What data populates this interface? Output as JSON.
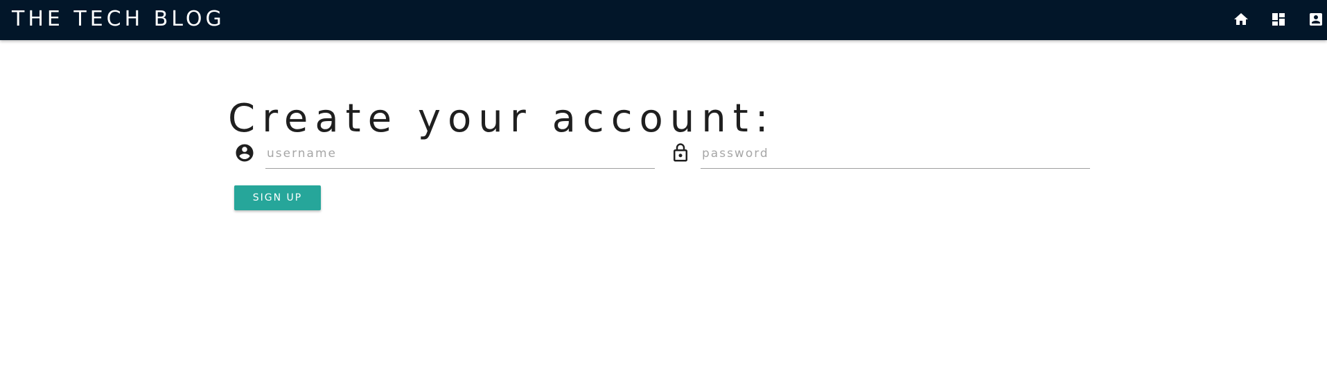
{
  "navbar": {
    "brand": "THE TECH BLOG",
    "icons": [
      "home-icon",
      "dashboard-icon",
      "account-box-icon"
    ],
    "background": "#021629"
  },
  "main": {
    "title": "Create your account:",
    "username": {
      "icon": "account-circle-icon",
      "placeholder": "username",
      "value": ""
    },
    "password": {
      "icon": "lock-icon",
      "placeholder": "password",
      "value": ""
    },
    "signup_label": "SIGN UP",
    "accent": "#26a69a"
  }
}
